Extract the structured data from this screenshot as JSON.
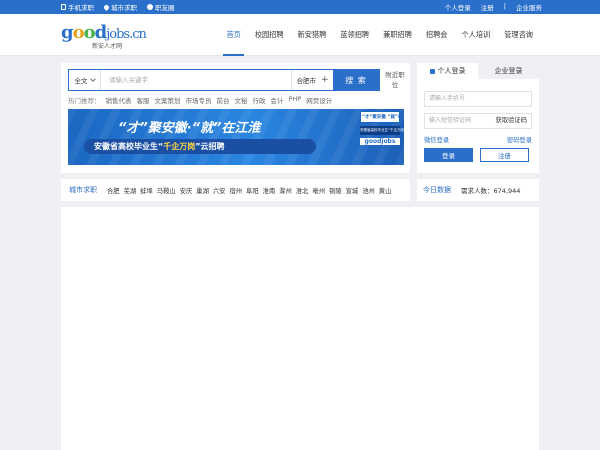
{
  "topbar": {
    "left": [
      {
        "icon": "mobile-icon",
        "label": "手机求职"
      },
      {
        "icon": "location-icon",
        "label": "城市求职"
      },
      {
        "icon": "people-icon",
        "label": "职友圈"
      }
    ],
    "right": [
      "个人登录",
      "注册",
      "|",
      "企业服务"
    ]
  },
  "logo": {
    "brand": "goodjobs.cn",
    "subtitle": "新安人才网"
  },
  "nav": {
    "items": [
      "首页",
      "校园招聘",
      "新安猎聘",
      "蓝领招聘",
      "兼职招聘",
      "招聘会",
      "个人培训",
      "管理咨询"
    ],
    "active": "首页"
  },
  "search": {
    "scope": "全文",
    "placeholder": "请输入关键字",
    "city": "合肥市",
    "button": "搜 索",
    "nearby": "附近职位"
  },
  "hot": {
    "label": "热门推荐：",
    "items": [
      "销售代表",
      "客服",
      "文案策划",
      "市场专员",
      "前台",
      "文秘",
      "行政",
      "会计",
      "PHP",
      "网页设计"
    ]
  },
  "banner": {
    "headline": "“才”聚安徽·“就”在江淮",
    "subline_prefix": "安徽省高校毕业生“",
    "subline_highlight": "千企万岗",
    "subline_suffix": "”云招聘",
    "side_top": "“才”聚安徽 “就”在江淮",
    "side_mid": "安徽省高校毕业生“千企万岗”云招聘",
    "side_logo": "goodjobs"
  },
  "login": {
    "tab_personal": "个人登录",
    "tab_company": "企业登录",
    "phone_placeholder": "请输入手机号",
    "sms_placeholder": "输入短信验证码",
    "get_code": "获取验证码",
    "wechat_login": "微信登录",
    "password_login": "密码登录",
    "login_button": "登录",
    "register_button": "注册"
  },
  "cities": {
    "title": "城市求职",
    "list": [
      "合肥",
      "芜湖",
      "蚌埠",
      "马鞍山",
      "安庆",
      "巢湖",
      "六安",
      "宿州",
      "阜阳",
      "淮南",
      "滁州",
      "淮北",
      "亳州",
      "铜陵",
      "宣城",
      "池州",
      "黄山"
    ]
  },
  "today": {
    "title": "今日数据",
    "label": "需求人数：",
    "value": "674,944"
  },
  "colors": {
    "primary": "#2a6fc9",
    "background": "#eef0f3",
    "highlight": "#ffd640"
  }
}
